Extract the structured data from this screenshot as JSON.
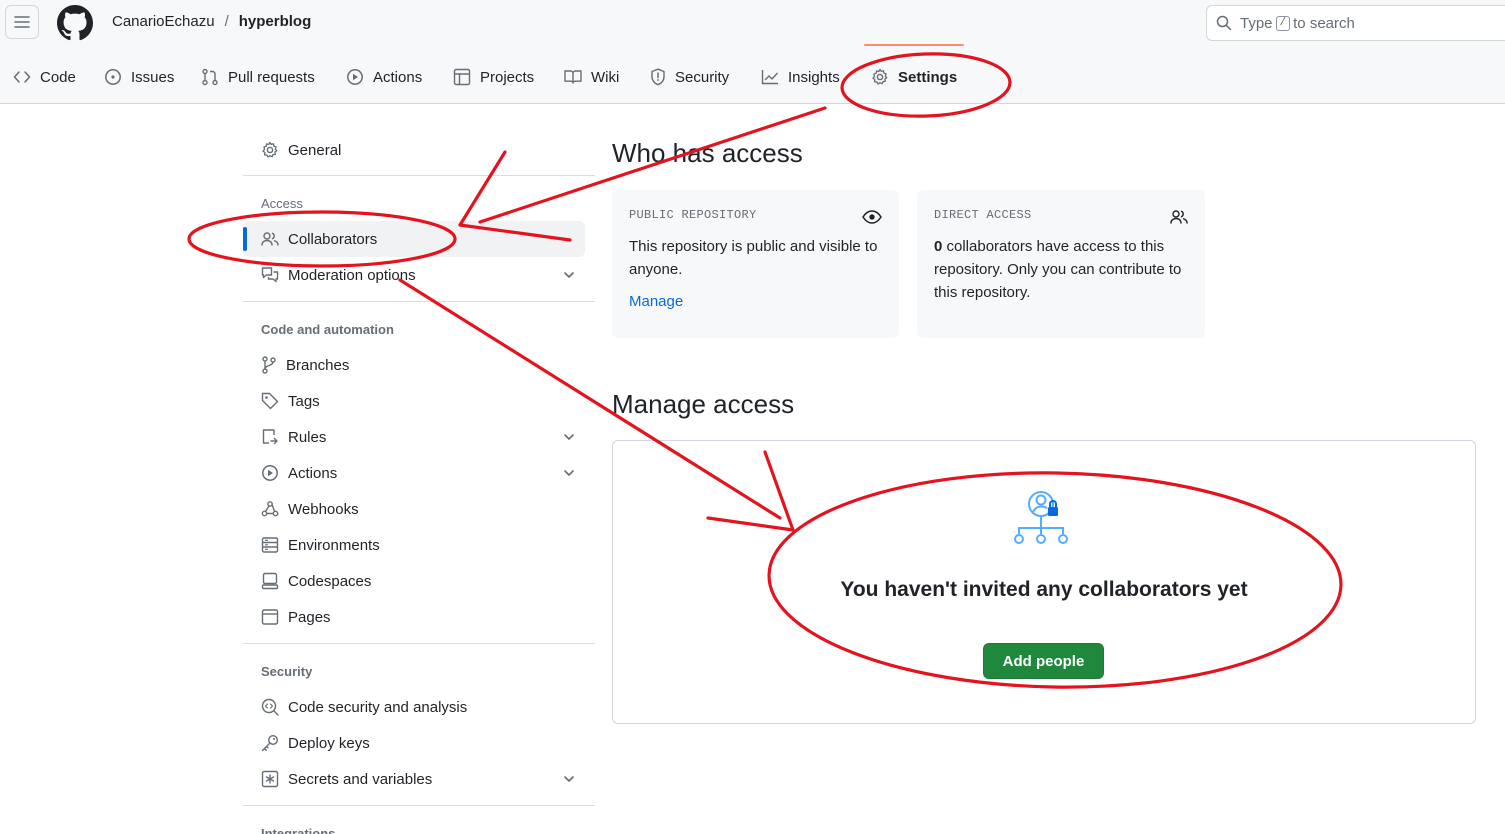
{
  "header": {
    "owner": "CanarioEchazu",
    "separator": "/",
    "repo": "hyperblog",
    "search": {
      "prefix": "Type",
      "key": "/",
      "suffix": "to search"
    }
  },
  "tabs": [
    {
      "label": "Code",
      "icon": "code-icon"
    },
    {
      "label": "Issues",
      "icon": "issue-icon"
    },
    {
      "label": "Pull requests",
      "icon": "pull-request-icon"
    },
    {
      "label": "Actions",
      "icon": "play-icon"
    },
    {
      "label": "Projects",
      "icon": "table-icon"
    },
    {
      "label": "Wiki",
      "icon": "book-icon"
    },
    {
      "label": "Security",
      "icon": "shield-icon"
    },
    {
      "label": "Insights",
      "icon": "graph-icon"
    },
    {
      "label": "Settings",
      "icon": "gear-icon",
      "active": true
    }
  ],
  "sidebar": {
    "general": "General",
    "groups": {
      "access": "Access",
      "code": "Code and automation",
      "security": "Security",
      "integrations": "Integrations"
    },
    "access_items": [
      "Collaborators",
      "Moderation options"
    ],
    "code_items": [
      "Branches",
      "Tags",
      "Rules",
      "Actions",
      "Webhooks",
      "Environments",
      "Codespaces",
      "Pages"
    ],
    "security_items": [
      "Code security and analysis",
      "Deploy keys",
      "Secrets and variables"
    ]
  },
  "main": {
    "who_title": "Who has access",
    "public_card": {
      "label": "PUBLIC REPOSITORY",
      "text": "This repository is public and visible to anyone.",
      "link": "Manage"
    },
    "direct_card": {
      "label": "DIRECT ACCESS",
      "count": "0",
      "text": " collaborators have access to this repository. Only you can contribute to this repository."
    },
    "manage_title": "Manage access",
    "empty_text": "You haven't invited any collaborators yet",
    "add_button": "Add people"
  },
  "colors": {
    "accent": "#0969da",
    "green": "#1f883d",
    "annotation": "#e3141f",
    "tab_underline": "#fd8c73"
  }
}
